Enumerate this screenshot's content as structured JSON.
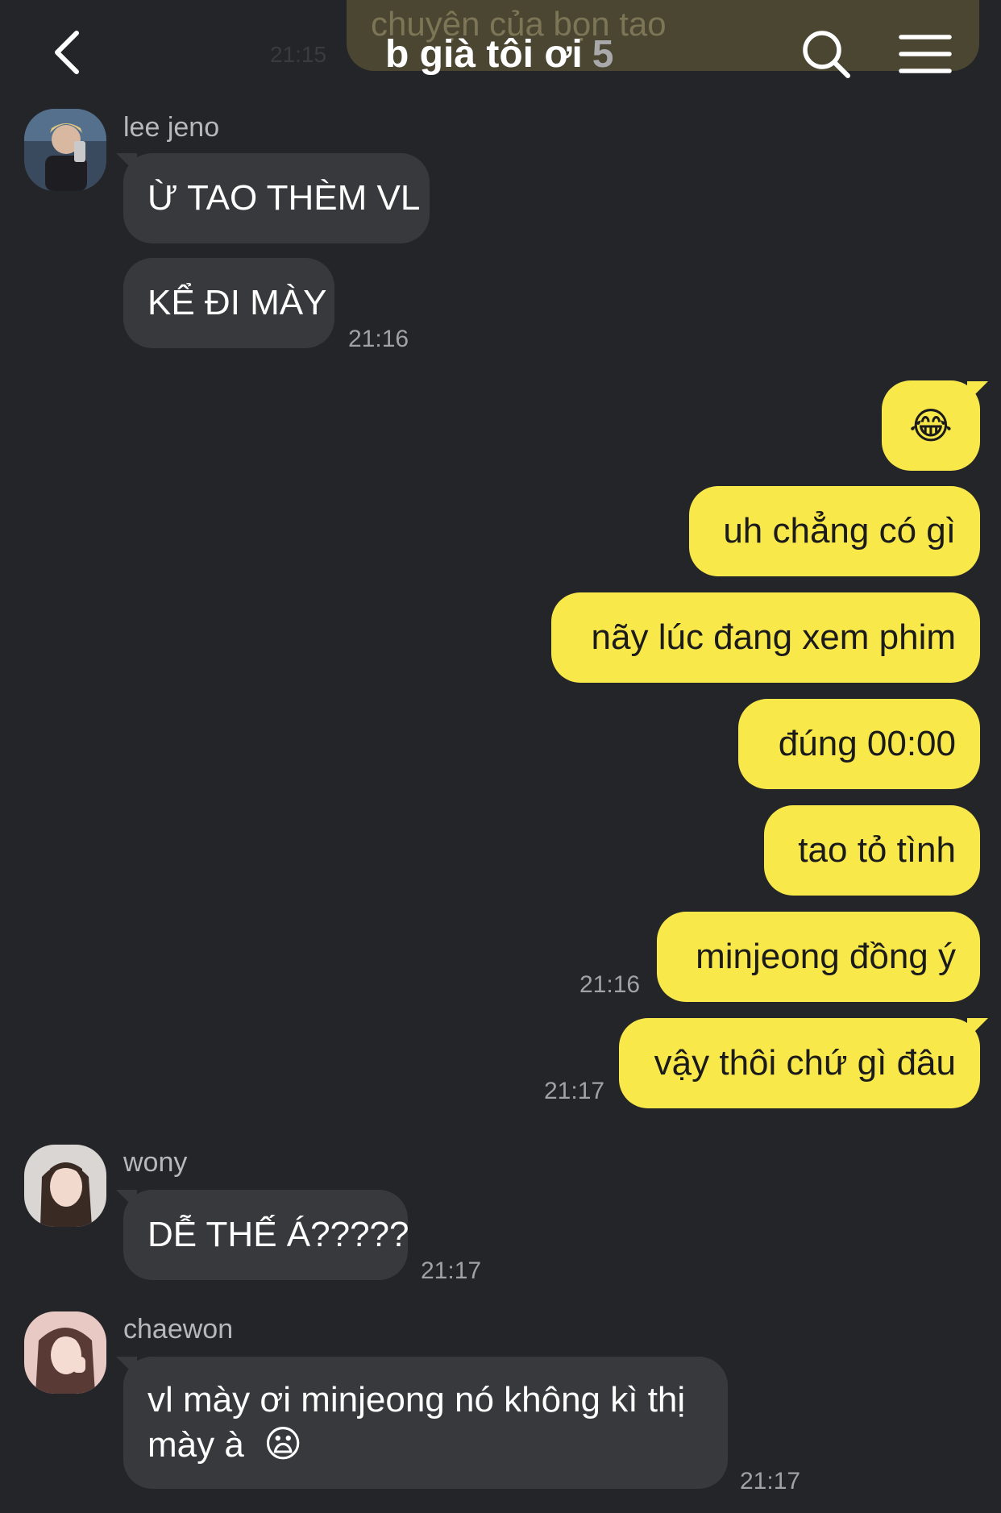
{
  "header": {
    "title": "b già tôi ơi",
    "member_count": "5",
    "icons": {
      "back": "chevron-left-icon",
      "search": "search-icon",
      "menu": "hamburger-menu-icon"
    }
  },
  "ghost": {
    "text": "chuyện của bọn tao",
    "time": "21:15"
  },
  "colors": {
    "background": "#242528",
    "incoming_bubble": "#38393c",
    "outgoing_bubble": "#f8e849",
    "timestamp": "#a2a2a4"
  },
  "messages": {
    "jeno": {
      "sender": "lee jeno",
      "line1": "Ừ TAO THÈM VL",
      "line2": "KỂ ĐI MÀY",
      "time": "21:16"
    },
    "me": {
      "m1": "😂",
      "m2": "uh chẳng có gì",
      "m3": "nãy lúc đang xem phim",
      "m4": "đúng 00:00",
      "m5": "tao tỏ tình",
      "m6": "minjeong đồng ý",
      "time1": "21:16",
      "m7": "vậy thôi chứ gì đâu",
      "time2": "21:17"
    },
    "wony": {
      "sender": "wony",
      "text": "DỄ THẾ Á?????",
      "time": "21:17"
    },
    "chaewon": {
      "sender": "chaewon",
      "line1": "vl mày ơi minjeong nó không kì thị",
      "line2": "mày à",
      "emoji": "😦",
      "time": "21:17"
    }
  }
}
